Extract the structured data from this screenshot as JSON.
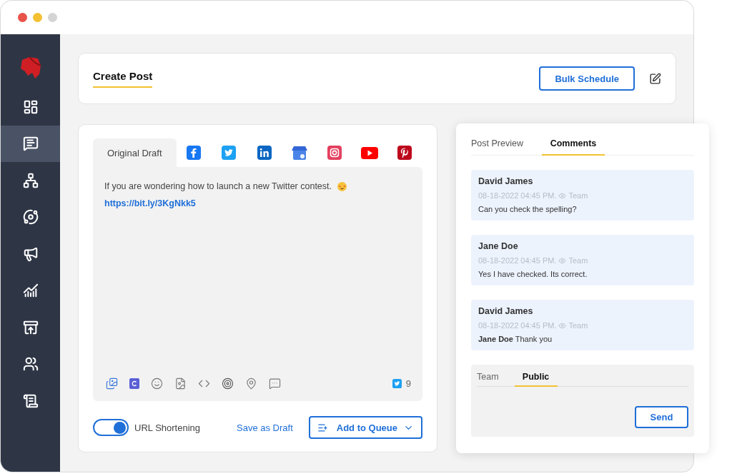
{
  "sidebar": {
    "items": [
      {
        "kind": "dashboard",
        "selected": false
      },
      {
        "kind": "compose",
        "selected": true
      },
      {
        "kind": "network",
        "selected": false
      },
      {
        "kind": "cycle",
        "selected": false
      },
      {
        "kind": "campaign",
        "selected": false
      },
      {
        "kind": "analytics",
        "selected": false
      },
      {
        "kind": "inbox",
        "selected": false
      },
      {
        "kind": "team",
        "selected": false
      },
      {
        "kind": "document",
        "selected": false
      }
    ]
  },
  "header": {
    "title": "Create Post",
    "bulk_button": "Bulk Schedule"
  },
  "composer": {
    "tabs": [
      {
        "kind": "text",
        "label": "Original Draft",
        "selected": true
      },
      {
        "kind": "facebook",
        "selected": false
      },
      {
        "kind": "twitter",
        "selected": false
      },
      {
        "kind": "linkedin",
        "selected": false
      },
      {
        "kind": "gmb",
        "selected": false
      },
      {
        "kind": "instagram",
        "selected": false
      },
      {
        "kind": "youtube",
        "selected": false
      },
      {
        "kind": "pinterest",
        "selected": false
      }
    ],
    "text": "If you are wondering how to launch a new Twitter contest.",
    "link": "https://bit.ly/3KgNkk5",
    "tools": [
      {
        "kind": "media"
      },
      {
        "kind": "canva"
      },
      {
        "kind": "emoji"
      },
      {
        "kind": "gif"
      },
      {
        "kind": "code"
      },
      {
        "kind": "target"
      },
      {
        "kind": "location"
      },
      {
        "kind": "comment"
      }
    ],
    "char_count": "9",
    "url_shortening": {
      "label": "URL Shortening",
      "on": true
    },
    "save_draft": "Save as Draft",
    "add_queue": "Add to Queue"
  },
  "panel": {
    "tabs": [
      {
        "label": "Post Preview",
        "selected": false
      },
      {
        "label": "Comments",
        "selected": true
      }
    ],
    "comments": [
      {
        "author": "David James",
        "time": "08-18-2022 04:45 PM.",
        "visibility": "Team",
        "text": "Can you check the spelling?"
      },
      {
        "author": "Jane Doe",
        "time": "08-18-2022 04:45 PM.",
        "visibility": "Team",
        "text": "Yes I have checked. Its correct."
      },
      {
        "author": "David James",
        "time": "08-18-2022 04:45 PM.",
        "visibility": "Team",
        "text": "**Jane Doe** Thank you"
      }
    ],
    "reply_tabs": [
      {
        "label": "Team",
        "selected": false
      },
      {
        "label": "Public",
        "selected": true
      }
    ],
    "send": "Send"
  }
}
